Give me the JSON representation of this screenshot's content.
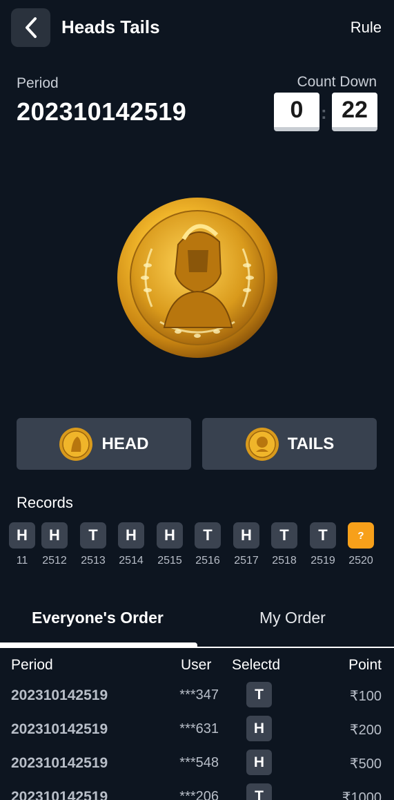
{
  "header": {
    "title": "Heads Tails",
    "rule_label": "Rule"
  },
  "period": {
    "label": "Period",
    "value": "202310142519"
  },
  "countdown": {
    "label": "Count Down",
    "minutes": "0",
    "separator": ":",
    "seconds": "22"
  },
  "bet_buttons": [
    {
      "label": "HEAD",
      "icon": "coin-icon"
    },
    {
      "label": "TAILS",
      "icon": "coin-icon"
    }
  ],
  "records": {
    "title": "Records",
    "items": [
      {
        "result": "H",
        "period": "11"
      },
      {
        "result": "H",
        "period": "2512"
      },
      {
        "result": "T",
        "period": "2513"
      },
      {
        "result": "H",
        "period": "2514"
      },
      {
        "result": "H",
        "period": "2515"
      },
      {
        "result": "T",
        "period": "2516"
      },
      {
        "result": "H",
        "period": "2517"
      },
      {
        "result": "T",
        "period": "2518"
      },
      {
        "result": "T",
        "period": "2519"
      },
      {
        "result": "?",
        "period": "2520"
      }
    ]
  },
  "tabs": [
    {
      "label": "Everyone's Order",
      "active": true
    },
    {
      "label": "My Order",
      "active": false
    }
  ],
  "table": {
    "headers": [
      "Period",
      "User",
      "Selectd",
      "Point"
    ],
    "rows": [
      {
        "period": "202310142519",
        "user": "***347",
        "selected": "T",
        "point": "₹100"
      },
      {
        "period": "202310142519",
        "user": "***631",
        "selected": "H",
        "point": "₹200"
      },
      {
        "period": "202310142519",
        "user": "***548",
        "selected": "H",
        "point": "₹500"
      },
      {
        "period": "202310142519",
        "user": "***206",
        "selected": "T",
        "point": "₹1000"
      }
    ]
  },
  "colors": {
    "background": "#0d1520",
    "button": "#38414f",
    "badge": "#3b4350",
    "pending": "#f7a01a",
    "gold": "#e8b22a"
  }
}
